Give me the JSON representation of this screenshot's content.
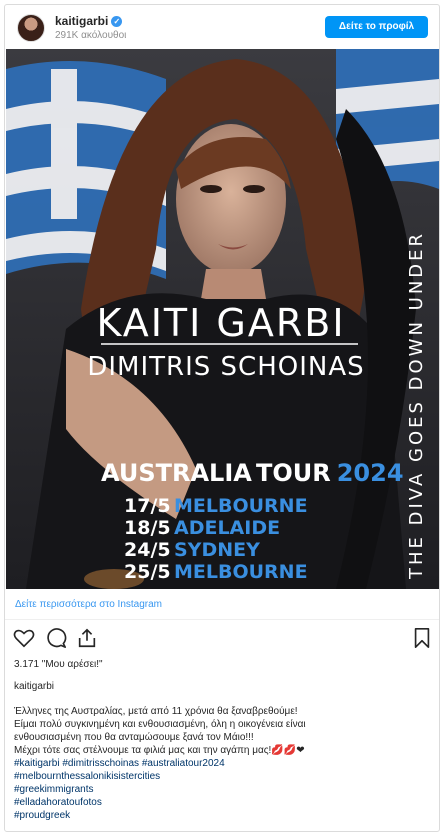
{
  "header": {
    "username": "kaitigarbi",
    "followers": "291K ακόλουθοι",
    "profile_button": "Δείτε το προφίλ"
  },
  "poster": {
    "artist_line1": "KAITI GARBI",
    "artist_line2": "DIMITRIS SCHOINAS",
    "tour_word1": "AUSTRALIA",
    "tour_word2": "TOUR",
    "tour_year": "2024",
    "side_text": "THE DIVA GOES DOWN UNDER",
    "dates": [
      {
        "date": "17/5",
        "city": "MELBOURNE"
      },
      {
        "date": "18/5",
        "city": "ADELAIDE"
      },
      {
        "date": "24/5",
        "city": "SYDNEY"
      },
      {
        "date": "25/5",
        "city": "MELBOURNE"
      }
    ],
    "colors": {
      "accent_blue": "#3a8fe0",
      "flag_blue": "#2f6fb8",
      "background": "#2b2b2e"
    }
  },
  "more_link": "Δείτε περισσότερα στο Instagram",
  "actions": {
    "icons": [
      "heart-icon",
      "comment-icon",
      "share-icon",
      "bookmark-icon"
    ]
  },
  "likes": "3.171 \"Μου αρέσει!\"",
  "caption": {
    "username": "kaitigarbi",
    "lines": [
      "Έλληνες της Αυστραλίας, μετά από 11 χρόνια θα ξαναβρεθούμε!",
      "Είμαι πολύ συγκινημένη και ενθουσιασμένη, όλη η οικογένεια είναι",
      "ενθουσιασμένη που θα ανταμώσουμε ξανά τον Μάιο!!!",
      "Μέχρι τότε σας στέλνουμε τα φιλιά μας και την αγάπη μας!💋💋❤"
    ],
    "hashtags": [
      "#kaitigarbi #dimitrisschoinas #australiatour2024",
      "#melbournthessalonikisistercities",
      "#greekimmigrants",
      "#elladahoratoufotos",
      "#proudgreek"
    ]
  }
}
